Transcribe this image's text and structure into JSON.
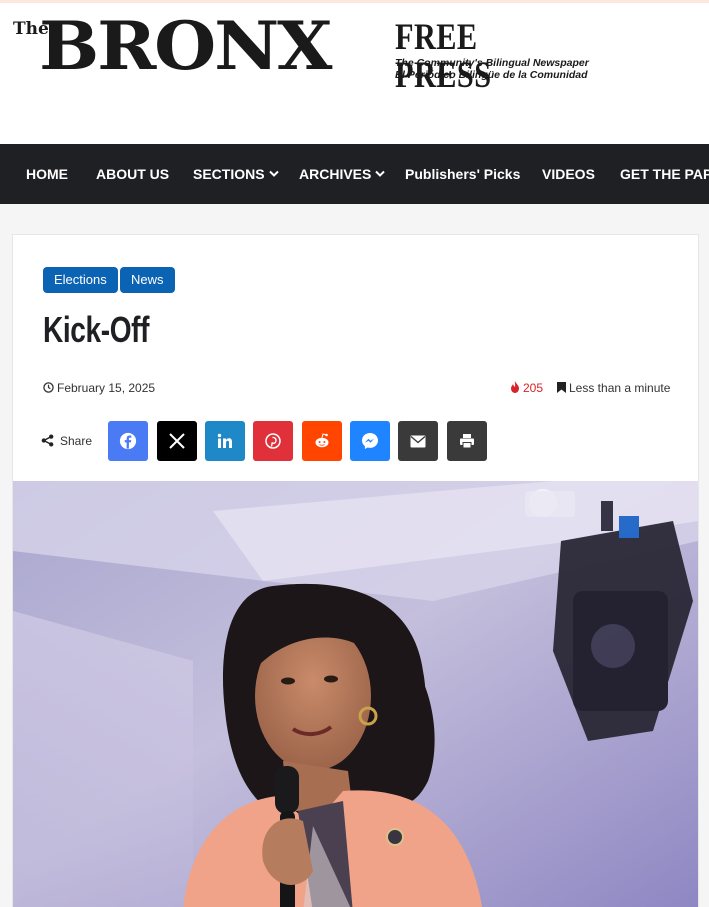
{
  "logo": {
    "the": "The",
    "bronx": "BRONX",
    "free_press": "FREE PRESS",
    "tagline_en": "The Community's Bilingual Newspaper",
    "tagline_es": "El Periódico Bilingüe de la Comunidad"
  },
  "nav": {
    "items": [
      {
        "label": "HOME"
      },
      {
        "label": "ABOUT US"
      },
      {
        "label": "SECTIONS",
        "dropdown": true
      },
      {
        "label": "ARCHIVES",
        "dropdown": true
      },
      {
        "label": "Publishers' Picks"
      },
      {
        "label": "VIDEOS"
      },
      {
        "label": "GET THE PAPER"
      }
    ],
    "background": "#1f2024"
  },
  "article": {
    "categories": [
      "Elections",
      "News"
    ],
    "category_color": "#0b63b4",
    "title": "Kick-Off",
    "date": "February 15, 2025",
    "views": "205",
    "read_time": "Less than a minute"
  },
  "share": {
    "label": "Share",
    "buttons": [
      {
        "name": "facebook",
        "icon": "facebook-icon",
        "color": "#4a7bf5"
      },
      {
        "name": "x",
        "icon": "x-icon",
        "color": "#000000"
      },
      {
        "name": "linkedin",
        "icon": "linkedin-icon",
        "color": "#1f88c7"
      },
      {
        "name": "pinterest",
        "icon": "pinterest-icon",
        "color": "#e0303a"
      },
      {
        "name": "reddit",
        "icon": "reddit-icon",
        "color": "#ff4500"
      },
      {
        "name": "messenger",
        "icon": "messenger-icon",
        "color": "#1f84ff"
      },
      {
        "name": "email",
        "icon": "envelope-icon",
        "color": "#3a3a3a"
      },
      {
        "name": "print",
        "icon": "printer-icon",
        "color": "#3a3a3a"
      }
    ]
  }
}
